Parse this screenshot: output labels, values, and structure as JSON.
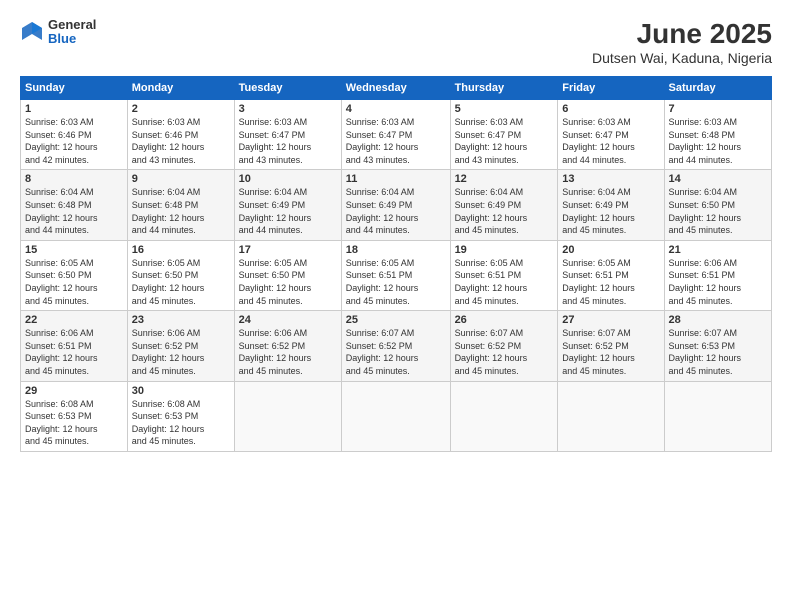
{
  "header": {
    "logo_general": "General",
    "logo_blue": "Blue",
    "month_title": "June 2025",
    "location": "Dutsen Wai, Kaduna, Nigeria"
  },
  "days_of_week": [
    "Sunday",
    "Monday",
    "Tuesday",
    "Wednesday",
    "Thursday",
    "Friday",
    "Saturday"
  ],
  "weeks": [
    [
      {
        "day": "1",
        "info": "Sunrise: 6:03 AM\nSunset: 6:46 PM\nDaylight: 12 hours\nand 42 minutes."
      },
      {
        "day": "2",
        "info": "Sunrise: 6:03 AM\nSunset: 6:46 PM\nDaylight: 12 hours\nand 43 minutes."
      },
      {
        "day": "3",
        "info": "Sunrise: 6:03 AM\nSunset: 6:47 PM\nDaylight: 12 hours\nand 43 minutes."
      },
      {
        "day": "4",
        "info": "Sunrise: 6:03 AM\nSunset: 6:47 PM\nDaylight: 12 hours\nand 43 minutes."
      },
      {
        "day": "5",
        "info": "Sunrise: 6:03 AM\nSunset: 6:47 PM\nDaylight: 12 hours\nand 43 minutes."
      },
      {
        "day": "6",
        "info": "Sunrise: 6:03 AM\nSunset: 6:47 PM\nDaylight: 12 hours\nand 44 minutes."
      },
      {
        "day": "7",
        "info": "Sunrise: 6:03 AM\nSunset: 6:48 PM\nDaylight: 12 hours\nand 44 minutes."
      }
    ],
    [
      {
        "day": "8",
        "info": "Sunrise: 6:04 AM\nSunset: 6:48 PM\nDaylight: 12 hours\nand 44 minutes."
      },
      {
        "day": "9",
        "info": "Sunrise: 6:04 AM\nSunset: 6:48 PM\nDaylight: 12 hours\nand 44 minutes."
      },
      {
        "day": "10",
        "info": "Sunrise: 6:04 AM\nSunset: 6:49 PM\nDaylight: 12 hours\nand 44 minutes."
      },
      {
        "day": "11",
        "info": "Sunrise: 6:04 AM\nSunset: 6:49 PM\nDaylight: 12 hours\nand 44 minutes."
      },
      {
        "day": "12",
        "info": "Sunrise: 6:04 AM\nSunset: 6:49 PM\nDaylight: 12 hours\nand 45 minutes."
      },
      {
        "day": "13",
        "info": "Sunrise: 6:04 AM\nSunset: 6:49 PM\nDaylight: 12 hours\nand 45 minutes."
      },
      {
        "day": "14",
        "info": "Sunrise: 6:04 AM\nSunset: 6:50 PM\nDaylight: 12 hours\nand 45 minutes."
      }
    ],
    [
      {
        "day": "15",
        "info": "Sunrise: 6:05 AM\nSunset: 6:50 PM\nDaylight: 12 hours\nand 45 minutes."
      },
      {
        "day": "16",
        "info": "Sunrise: 6:05 AM\nSunset: 6:50 PM\nDaylight: 12 hours\nand 45 minutes."
      },
      {
        "day": "17",
        "info": "Sunrise: 6:05 AM\nSunset: 6:50 PM\nDaylight: 12 hours\nand 45 minutes."
      },
      {
        "day": "18",
        "info": "Sunrise: 6:05 AM\nSunset: 6:51 PM\nDaylight: 12 hours\nand 45 minutes."
      },
      {
        "day": "19",
        "info": "Sunrise: 6:05 AM\nSunset: 6:51 PM\nDaylight: 12 hours\nand 45 minutes."
      },
      {
        "day": "20",
        "info": "Sunrise: 6:05 AM\nSunset: 6:51 PM\nDaylight: 12 hours\nand 45 minutes."
      },
      {
        "day": "21",
        "info": "Sunrise: 6:06 AM\nSunset: 6:51 PM\nDaylight: 12 hours\nand 45 minutes."
      }
    ],
    [
      {
        "day": "22",
        "info": "Sunrise: 6:06 AM\nSunset: 6:51 PM\nDaylight: 12 hours\nand 45 minutes."
      },
      {
        "day": "23",
        "info": "Sunrise: 6:06 AM\nSunset: 6:52 PM\nDaylight: 12 hours\nand 45 minutes."
      },
      {
        "day": "24",
        "info": "Sunrise: 6:06 AM\nSunset: 6:52 PM\nDaylight: 12 hours\nand 45 minutes."
      },
      {
        "day": "25",
        "info": "Sunrise: 6:07 AM\nSunset: 6:52 PM\nDaylight: 12 hours\nand 45 minutes."
      },
      {
        "day": "26",
        "info": "Sunrise: 6:07 AM\nSunset: 6:52 PM\nDaylight: 12 hours\nand 45 minutes."
      },
      {
        "day": "27",
        "info": "Sunrise: 6:07 AM\nSunset: 6:52 PM\nDaylight: 12 hours\nand 45 minutes."
      },
      {
        "day": "28",
        "info": "Sunrise: 6:07 AM\nSunset: 6:53 PM\nDaylight: 12 hours\nand 45 minutes."
      }
    ],
    [
      {
        "day": "29",
        "info": "Sunrise: 6:08 AM\nSunset: 6:53 PM\nDaylight: 12 hours\nand 45 minutes."
      },
      {
        "day": "30",
        "info": "Sunrise: 6:08 AM\nSunset: 6:53 PM\nDaylight: 12 hours\nand 45 minutes."
      },
      {
        "day": "",
        "info": ""
      },
      {
        "day": "",
        "info": ""
      },
      {
        "day": "",
        "info": ""
      },
      {
        "day": "",
        "info": ""
      },
      {
        "day": "",
        "info": ""
      }
    ]
  ]
}
